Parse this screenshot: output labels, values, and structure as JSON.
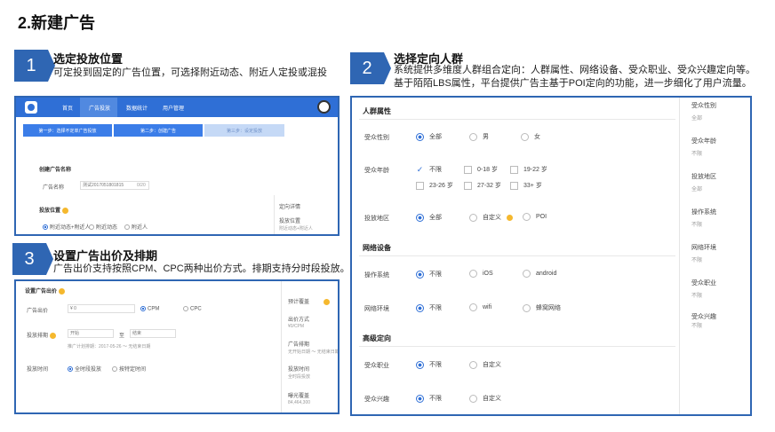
{
  "page_title": "2.新建广告",
  "steps": [
    {
      "num": "1",
      "title": "选定投放位置",
      "desc": [
        "可定投到固定的广告位置，可选择附近动态、附近人定投或混投"
      ]
    },
    {
      "num": "2",
      "title": "选择定向人群",
      "desc": [
        "系统提供多维度人群组合定向：人群属性、网络设备、受众职业、受众兴趣定向等。",
        "基于陌陌LBS属性，平台提供广告主基于POI定向的功能，进一步细化了用户流量。"
      ]
    },
    {
      "num": "3",
      "title": "设置广告出价及排期",
      "desc": [
        "广告出价支持按照CPM、CPC两种出价方式。排期支持分时段投放。"
      ]
    }
  ],
  "shot1": {
    "nav": [
      "首页",
      "广告投放",
      "数据统计",
      "用户管理"
    ],
    "progress": [
      "第一步：选择不定单广告投放",
      "第二步：创建广告",
      "第三步：设定投放"
    ],
    "name_section": "创建广告名称",
    "name_label": "广告名称",
    "name_value": "测试2017051801815",
    "name_count": "0/20",
    "position_section": "投放位置",
    "positions": [
      "附近动态+附近人",
      "附近动态",
      "附近人"
    ],
    "right_title": "定向详情",
    "right_label": "投放位置",
    "right_value": "附近动态+附近人"
  },
  "shot2": {
    "sec_crowd": "人群属性",
    "gender_label": "受众性别",
    "gender": [
      "全部",
      "男",
      "女"
    ],
    "age_label": "受众年龄",
    "ages_row1": [
      "不限",
      "0-18 岁",
      "19-22 岁"
    ],
    "ages_row2": [
      "23-26 岁",
      "27-32 岁",
      "33+ 岁"
    ],
    "region_label": "投放地区",
    "region": [
      "全部",
      "自定义",
      "POI"
    ],
    "sec_net": "网络设备",
    "os_label": "操作系统",
    "os": [
      "不限",
      "iOS",
      "android"
    ],
    "net_label": "网络环境",
    "net": [
      "不限",
      "wifi",
      "蜂窝网络"
    ],
    "sec_adv": "高级定向",
    "job_label": "受众职业",
    "job": [
      "不限",
      "自定义"
    ],
    "interest_label": "受众兴趣",
    "interest": [
      "不限",
      "自定义"
    ],
    "side": [
      {
        "t": "受众性别",
        "v": "全部"
      },
      {
        "t": "受众年龄",
        "v": "不限"
      },
      {
        "t": "投放地区",
        "v": "全部"
      },
      {
        "t": "操作系统",
        "v": "不限"
      },
      {
        "t": "网络环境",
        "v": "不限"
      },
      {
        "t": "受众职业",
        "v": "不限"
      },
      {
        "t": "受众兴趣",
        "v": "不限"
      }
    ]
  },
  "shot3": {
    "section": "设置广告出价",
    "bid_label": "广告出价",
    "bid_prefix": "¥",
    "bid_value": "0",
    "bid_types": [
      "CPM",
      "CPC"
    ],
    "schedule_label": "投放排期",
    "start_placeholder": "开始",
    "to": "至",
    "end_placeholder": "结束",
    "schedule_hint": "推广计划排期：2017-05-26 ～ 无结束日期",
    "time_label": "投放时间",
    "times": [
      "全时段投放",
      "按特定时间"
    ],
    "right": [
      {
        "t": "预计覆盖",
        "v": ""
      },
      {
        "t": "出价方式",
        "v": "¥0/CPM"
      },
      {
        "t": "广告排期",
        "v": "无开始日期 ～ 无结束日期"
      },
      {
        "t": "投放时间",
        "v": "全时段投放"
      },
      {
        "t": "曝光覆盖",
        "v": "84,464,300"
      }
    ]
  },
  "colors": {
    "accent": "#2f66b3",
    "ui_blue": "#2f6fd6",
    "info": "#f5b82e"
  }
}
